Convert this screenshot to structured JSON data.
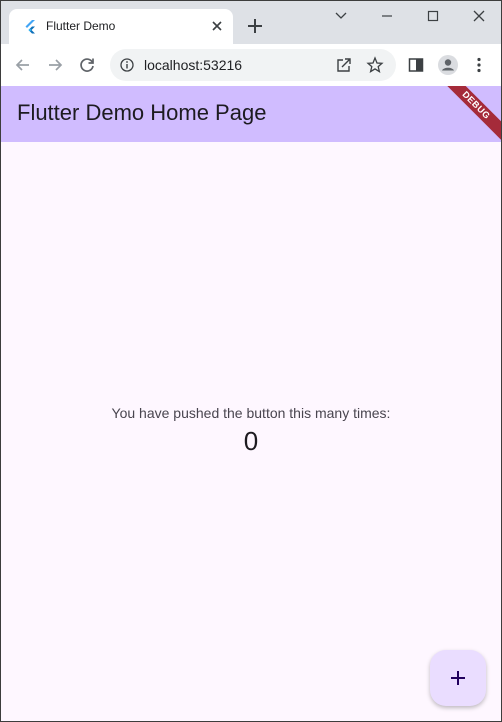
{
  "browser": {
    "tab": {
      "title": "Flutter Demo",
      "favicon": "flutter-logo-icon",
      "close_icon": "close-icon"
    },
    "new_tab_icon": "plus-icon",
    "window_controls": [
      "chevron-down-icon",
      "minimize-icon",
      "maximize-icon",
      "close-icon"
    ],
    "toolbar": {
      "back_icon": "arrow-left-icon",
      "forward_icon": "arrow-right-icon",
      "reload_icon": "reload-icon",
      "site_info_icon": "info-icon",
      "url": "localhost:53216",
      "share_icon": "share-icon",
      "bookmark_icon": "star-icon",
      "side_panel_icon": "side-panel-icon",
      "profile_icon": "profile-icon",
      "menu_icon": "kebab-menu-icon"
    }
  },
  "app": {
    "appbar_title": "Flutter Demo Home Page",
    "debug_banner": "DEBUG",
    "counter_label": "You have pushed the button this many times:",
    "counter_value": "0",
    "fab_icon": "plus-icon"
  },
  "colors": {
    "tabstrip_bg": "#dee1e6",
    "appbar_bg": "#d0bcff",
    "app_bg": "#fef7ff",
    "fab_bg": "#eaddff",
    "debug_banner_bg": "#a52b3a",
    "fab_icon": "#21005d"
  }
}
